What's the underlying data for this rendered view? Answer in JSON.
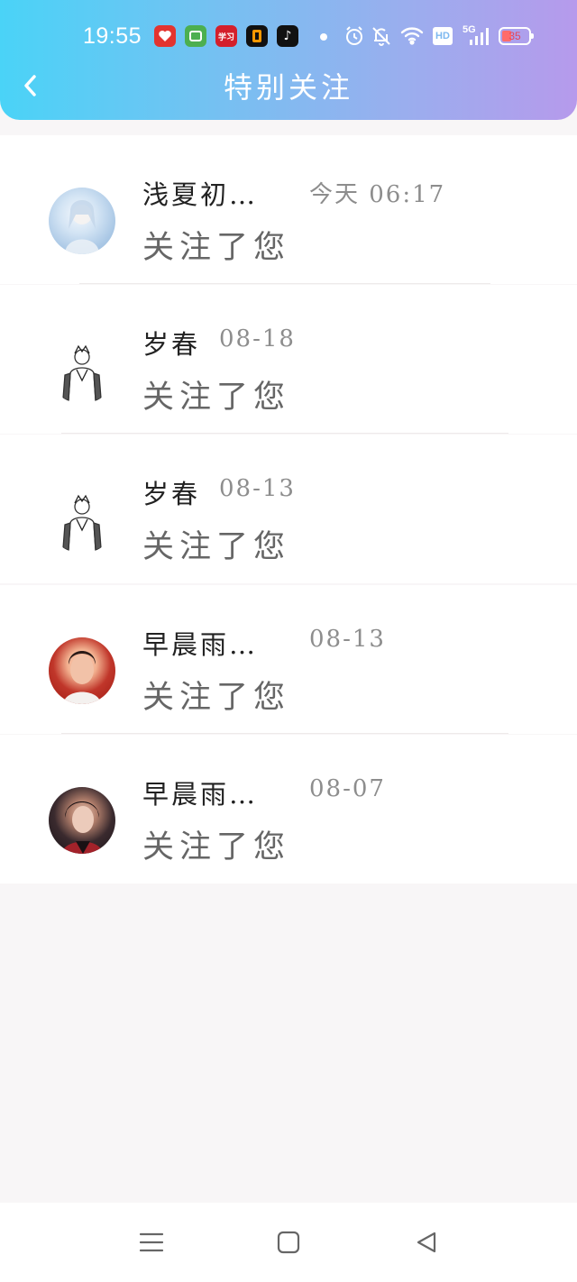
{
  "status_bar": {
    "time": "19:55",
    "app3_label": "学习",
    "app5_label": "♪",
    "hd_label": "HD",
    "network_label": "5G",
    "battery_level": "35"
  },
  "header": {
    "title": "特别关注"
  },
  "items": [
    {
      "name": "浅夏初…",
      "time": "今天 06:17",
      "message": "关注了您"
    },
    {
      "name": "岁春",
      "time": "08-18",
      "message": "关注了您"
    },
    {
      "name": "岁春",
      "time": "08-13",
      "message": "关注了您"
    },
    {
      "name": "早晨雨…",
      "time": "08-13",
      "message": "关注了您"
    },
    {
      "name": "早晨雨…",
      "time": "08-07",
      "message": "关注了您"
    }
  ],
  "colors": {
    "header_gradient_start": "#4ad3f7",
    "header_gradient_end": "#b69aec",
    "page_background": "#f8f6f7",
    "text_primary": "#222222",
    "text_secondary": "#8d8d8d"
  },
  "icons": {
    "back": "chevron-left-icon",
    "nav_menu": "menu-icon",
    "nav_home": "square-home-icon",
    "nav_back": "triangle-back-icon"
  }
}
